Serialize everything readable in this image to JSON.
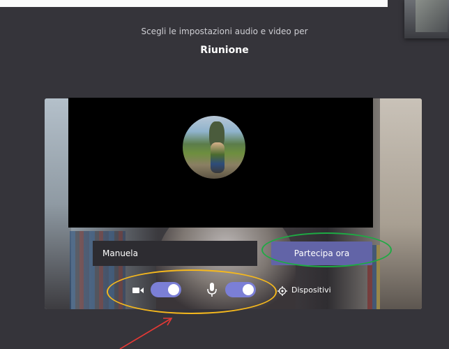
{
  "header": {
    "subtitle": "Scegli le impostazioni audio e video per",
    "meeting_title": "Riunione"
  },
  "join_panel": {
    "name_value": "Manuela",
    "join_button_label": "Partecipa ora"
  },
  "controls": {
    "video_on": true,
    "audio_on": true,
    "devices_label": "Dispositivi"
  },
  "icons": {
    "camera": "camera-icon",
    "microphone": "microphone-icon",
    "settings": "gear-icon"
  },
  "annotations": {
    "join_highlight_color": "#1eaa44",
    "controls_highlight_color": "#f5b81d",
    "arrow_color": "#e53935"
  },
  "colors": {
    "accent": "#6264a7",
    "toggle_on": "#7b7fd6",
    "background": "#35343a"
  }
}
